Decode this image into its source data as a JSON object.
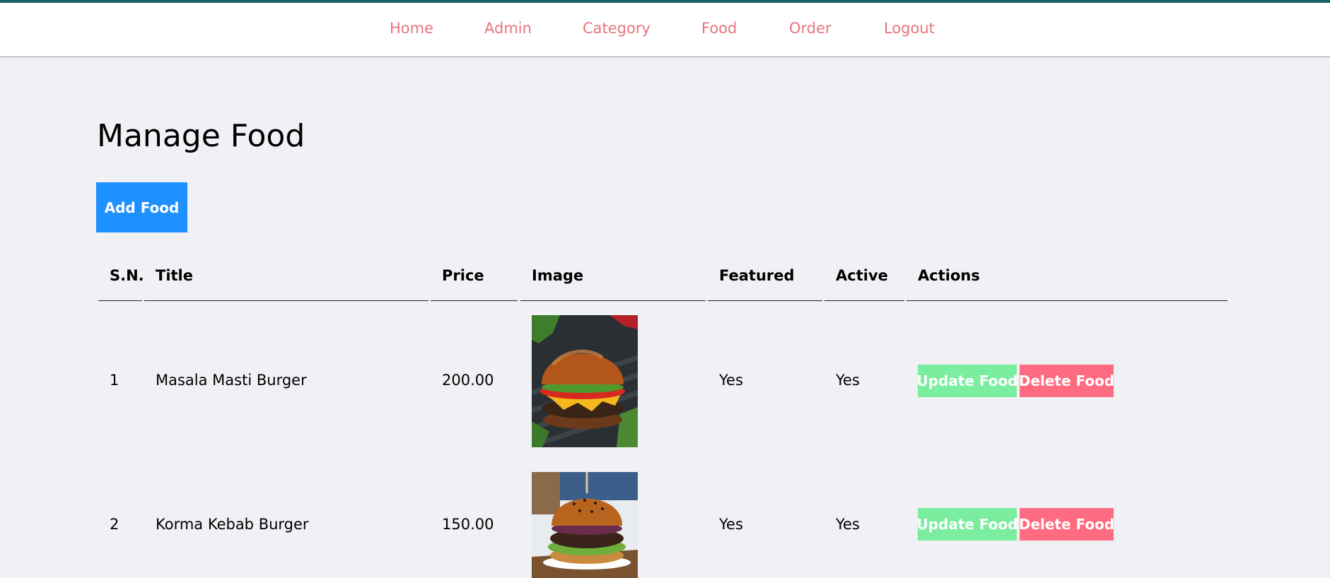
{
  "nav": {
    "home": "Home",
    "admin": "Admin",
    "category": "Category",
    "food": "Food",
    "order": "Order",
    "logout": "Logout"
  },
  "page": {
    "title": "Manage Food",
    "add_button": "Add Food"
  },
  "table": {
    "headers": {
      "sn": "S.N.",
      "title": "Title",
      "price": "Price",
      "image": "Image",
      "featured": "Featured",
      "active": "Active",
      "actions": "Actions"
    },
    "rows": [
      {
        "sn": "1",
        "title": "Masala Masti Burger",
        "price": "200.00",
        "featured": "Yes",
        "active": "Yes",
        "update_label": "Update Food",
        "delete_label": "Delete Food"
      },
      {
        "sn": "2",
        "title": "Korma Kebab Burger",
        "price": "150.00",
        "featured": "Yes",
        "active": "Yes",
        "update_label": "Update Food",
        "delete_label": "Delete Food"
      }
    ]
  },
  "colors": {
    "nav_link": "#e8747c",
    "add_button": "#1e90ff",
    "update_button": "#7bed9f",
    "delete_button": "#ff6b81",
    "background": "#f0f1f5"
  }
}
